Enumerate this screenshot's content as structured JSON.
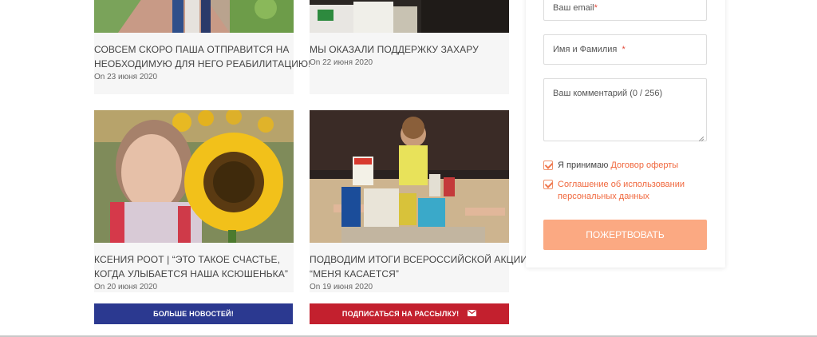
{
  "news": {
    "cards": [
      {
        "title_line1": "СОВСЕМ СКОРО ПАША ОТПРАВИТСЯ НА",
        "title_line2": "НЕОБХОДИМУЮ ДЛЯ НЕГО РЕАБИЛИТАЦИЮ!",
        "date": "On 23 июня 2020",
        "image": "photo-child-walking-park"
      },
      {
        "title_line1": "МЫ ОКАЗАЛИ ПОДДЕРЖКУ ЗАХАРУ",
        "title_line2": "",
        "date": "On 22 июня 2020",
        "image": "photo-groceries"
      },
      {
        "title_line1": "КСЕНИЯ РООТ | “ЭТО ТАКОЕ СЧАСТЬЕ,",
        "title_line2": "КОГДА УЛЫБАЕТСЯ НАША КСЮШЕНЬКА”",
        "date": "On 20 июня 2020",
        "image": "photo-girl-sunflower"
      },
      {
        "title_line1": "ПОДВОДИМ ИТОГИ ВСЕРОССИЙСКОЙ АКЦИИ",
        "title_line2": "“МЕНЯ КАСАЕТСЯ”",
        "date": "On 19 июня 2020",
        "image": "photo-girl-with-food"
      }
    ],
    "more_news_label": "БОЛЬШЕ НОВОСТЕЙ!",
    "subscribe_label": "ПОДПИСАТЬСЯ НА РАССЫЛКУ!",
    "subscribe_icon": "envelope-icon"
  },
  "form": {
    "email_placeholder": "Ваш email",
    "name_placeholder": "Имя и Фамилия",
    "comment_placeholder": "Ваш комментарий (0 / 256)",
    "required_mark": "*",
    "offer_prefix": "Я принимаю",
    "offer_link": "Договор оферты",
    "privacy_line1": "Соглашение об использовании",
    "privacy_line2": "персональных данных",
    "donate_label": "ПОЖЕРТВОВАТЬ"
  },
  "colors": {
    "blue_button": "#2b3990",
    "red_button": "#c3202e",
    "donate_button": "#fba982",
    "link_orange": "#f0683e"
  }
}
